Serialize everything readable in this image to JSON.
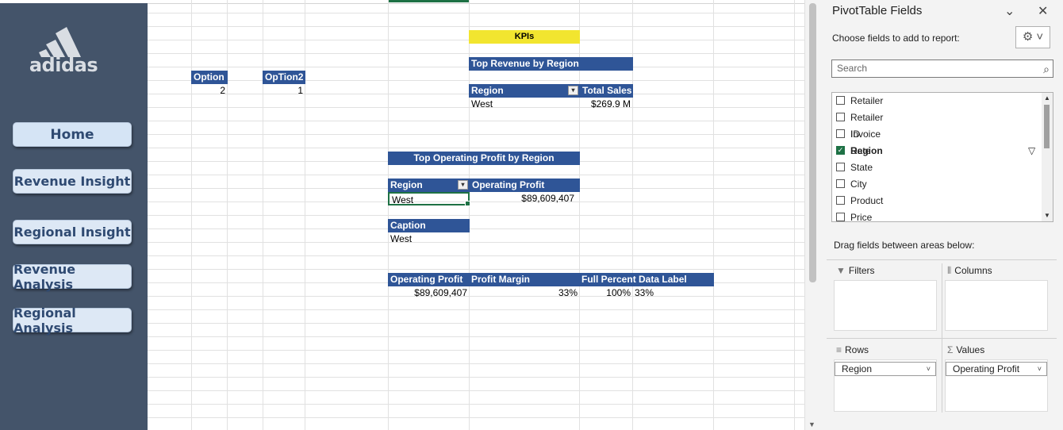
{
  "sidebar": {
    "brand": "adidas",
    "nav": [
      {
        "label": "Home"
      },
      {
        "label": "Revenue Insight"
      },
      {
        "label": "Regional Insight"
      },
      {
        "label": "Revenue Analysis"
      },
      {
        "label": "Regional Analysis"
      }
    ]
  },
  "sheet": {
    "option_header": "Option",
    "option_value": "2",
    "option2_header": "OpTion2",
    "option2_value": "1",
    "kpis_label": "KPIs",
    "top_revenue": {
      "title": "Top Revenue by Region",
      "col_region": "Region",
      "col_total": "Total Sales",
      "region": "West",
      "total": "$269.9 M"
    },
    "top_profit": {
      "title": "Top Operating Profit by Region",
      "col_region": "Region",
      "col_profit": "Operating Profit",
      "region": "West",
      "profit": "$89,609,407"
    },
    "caption": {
      "header": "Caption",
      "value": "West"
    },
    "summary": {
      "col_profit": "Operating Profit",
      "col_margin": "Profit Margin",
      "col_label": "Full Percent Data Label",
      "profit": "$89,609,407",
      "margin": "33%",
      "full": "100%",
      "label": "33%"
    }
  },
  "pane": {
    "title": "PivotTable Fields",
    "choose_label": "Choose fields to add to report:",
    "search_placeholder": "Search",
    "fields": [
      {
        "label": "Retailer",
        "checked": false
      },
      {
        "label": "Retailer ID",
        "checked": false
      },
      {
        "label": "Invoice Date",
        "checked": false
      },
      {
        "label": "Region",
        "checked": true
      },
      {
        "label": "State",
        "checked": false
      },
      {
        "label": "City",
        "checked": false
      },
      {
        "label": "Product",
        "checked": false
      },
      {
        "label": "Price per Unit",
        "checked": false
      }
    ],
    "drag_label": "Drag fields between areas below:",
    "areas": {
      "filters": "Filters",
      "columns": "Columns",
      "rows": "Rows",
      "values": "Values"
    },
    "rows_item": "Region",
    "values_item": "Operating Profit"
  },
  "colors": {
    "sidebar": "#44546a",
    "header": "#2f5597",
    "kpi": "#f2e52f",
    "nav_button": "#dde8f5"
  }
}
